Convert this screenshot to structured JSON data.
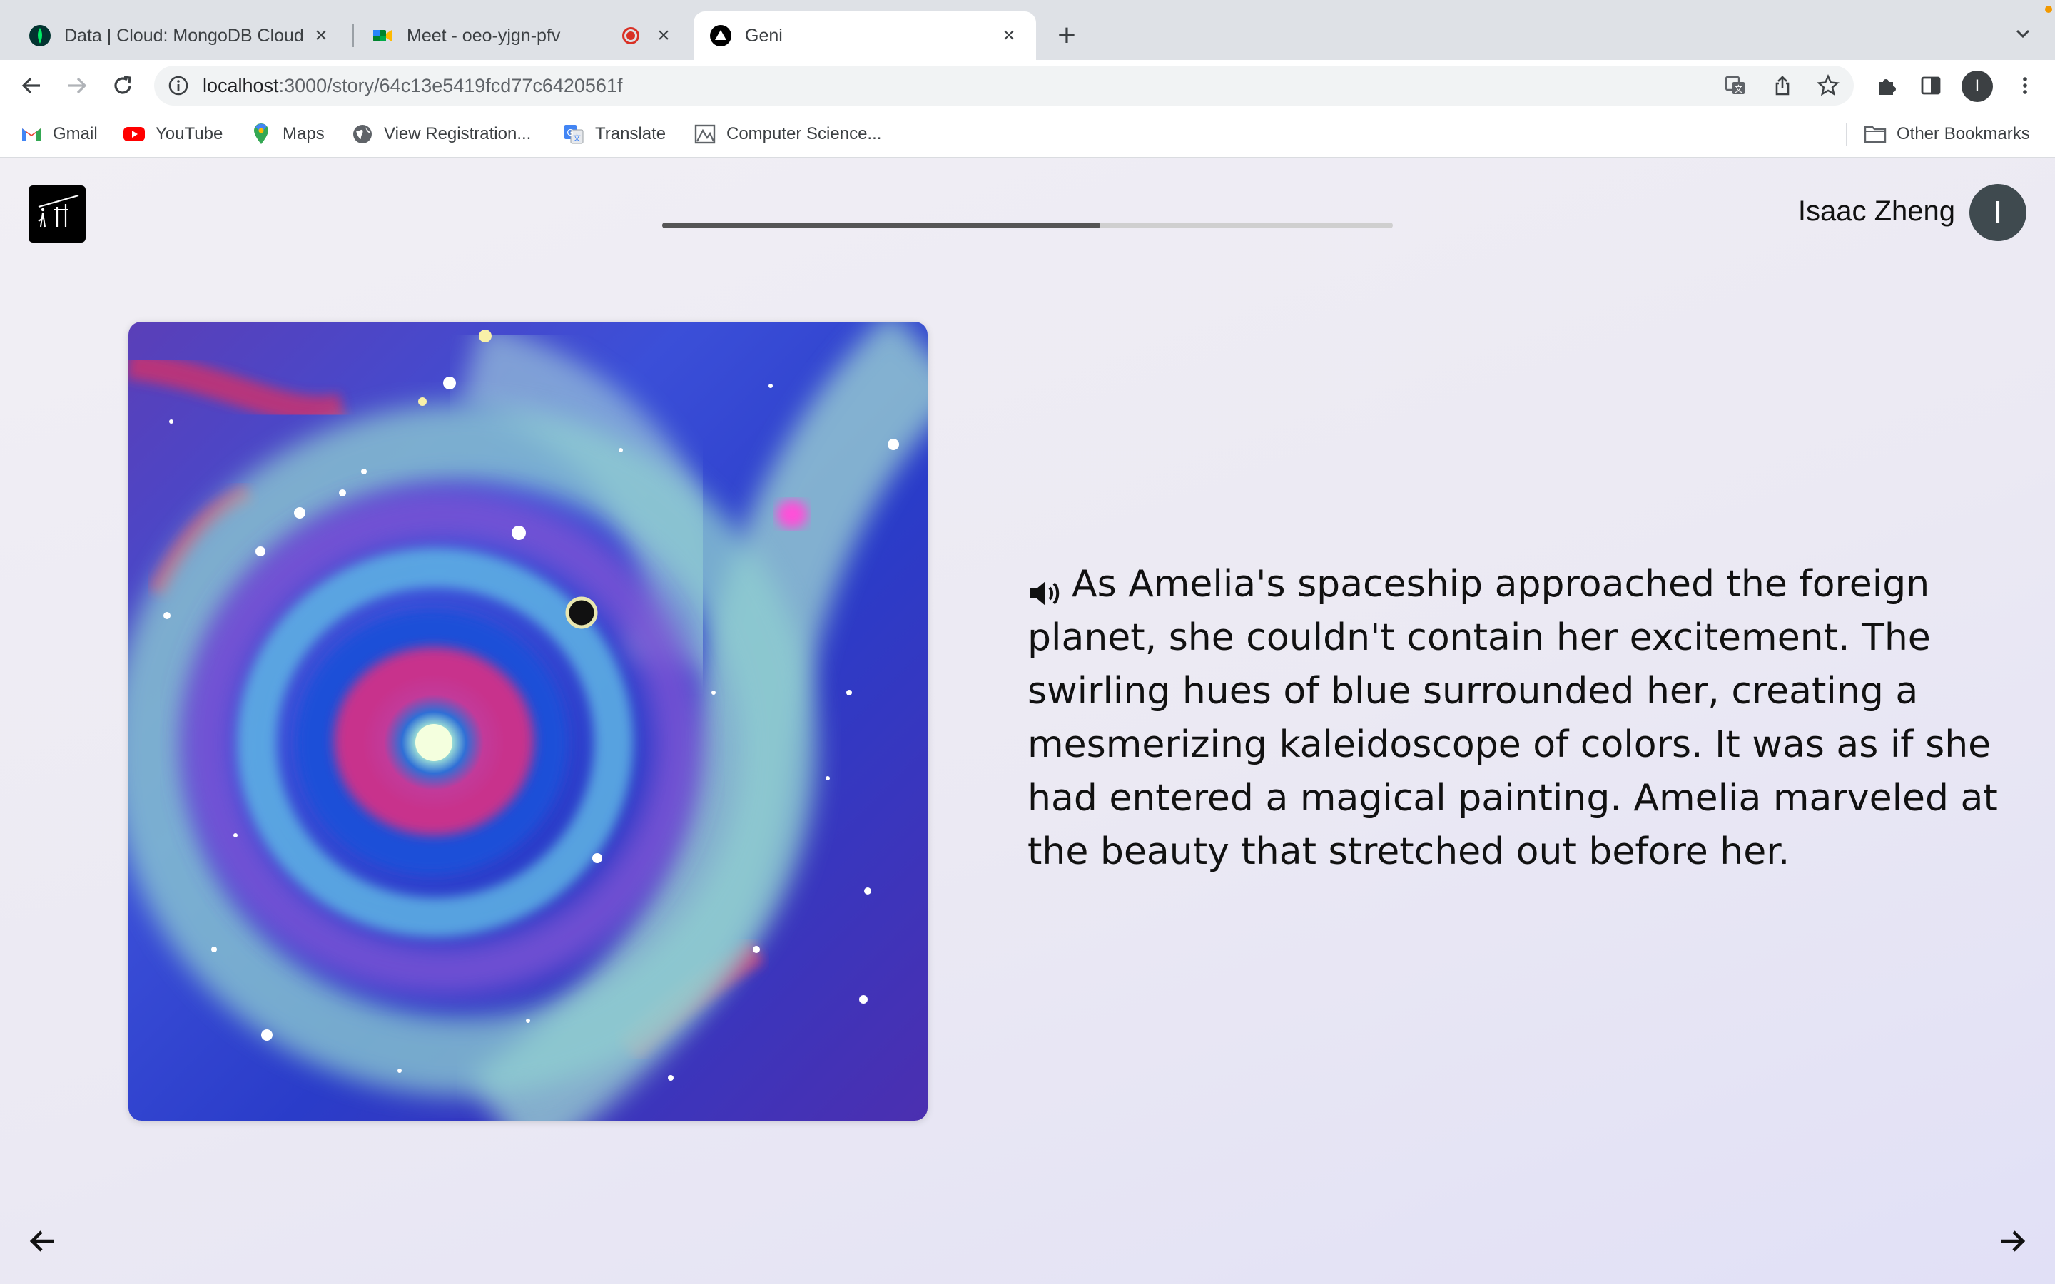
{
  "browser": {
    "tabs": [
      {
        "title": "Data | Cloud: MongoDB Cloud",
        "icon": "mongodb-leaf-icon",
        "active": false
      },
      {
        "title": "Meet - oeo-yjgn-pfv",
        "icon": "google-meet-icon",
        "active": false,
        "recording": true
      },
      {
        "title": "Geni",
        "icon": "geni-triangle-icon",
        "active": true
      }
    ],
    "url_host": "localhost",
    "url_rest": ":3000/story/64c13e5419fcd77c6420561f",
    "profile_initial": "I"
  },
  "bookmarks": [
    {
      "label": "Gmail",
      "icon": "gmail-icon"
    },
    {
      "label": "YouTube",
      "icon": "youtube-icon"
    },
    {
      "label": "Maps",
      "icon": "maps-pin-icon"
    },
    {
      "label": "View Registration...",
      "icon": "globe-icon"
    },
    {
      "label": "Translate",
      "icon": "translate-icon"
    },
    {
      "label": "Computer Science...",
      "icon": "bookmark-image-icon"
    }
  ],
  "other_bookmarks": "Other Bookmarks",
  "app": {
    "user_name": "Isaac Zheng",
    "user_initial": "I",
    "progress": 0.6,
    "story_text": "As Amelia's spaceship approached the foreign planet, she couldn't contain her excitement. The swirling hues of blue surrounded her, creating a mesmerizing kaleidoscope of colors. It was as if she had entered a magical painting. Amelia marveled at the beauty that stretched out before her.",
    "image_icon": "galaxy-swirl-painting"
  }
}
